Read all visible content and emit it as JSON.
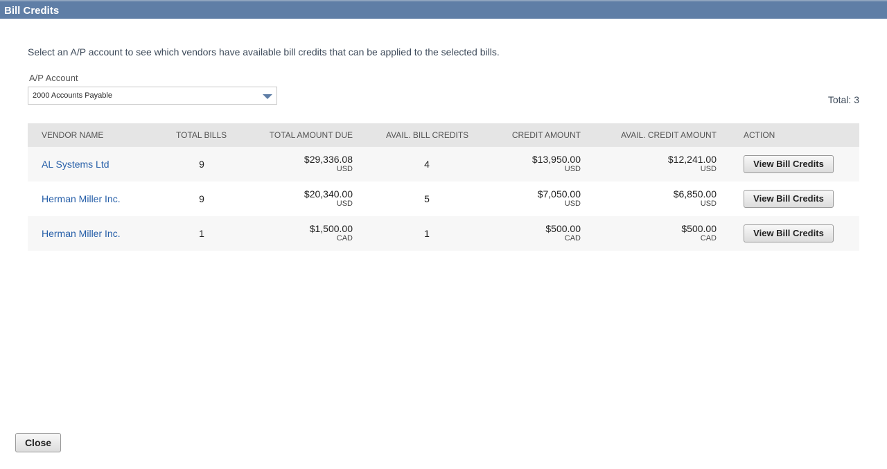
{
  "window": {
    "title": "Bill Credits"
  },
  "instructions": "Select an A/P account to see which vendors have available bill credits that can be applied to the selected bills.",
  "ap_account": {
    "label": "A/P Account",
    "selected": "2000 Accounts Payable",
    "icon": "chevron-down-icon"
  },
  "total": "Total: 3",
  "table": {
    "headers": {
      "vendor_name": "VENDOR NAME",
      "total_bills": "TOTAL BILLS",
      "total_amount_due": "TOTAL AMOUNT DUE",
      "avail_bill_credits": "AVAIL. BILL CREDITS",
      "credit_amount": "CREDIT AMOUNT",
      "avail_credit_amount": "AVAIL. CREDIT AMOUNT",
      "action": "ACTION"
    },
    "rows": [
      {
        "vendor": "AL Systems Ltd",
        "total_bills": "9",
        "total_amount_due": "$29,336.08",
        "total_amount_due_currency": "USD",
        "avail_bill_credits": "4",
        "credit_amount": "$13,950.00",
        "credit_amount_currency": "USD",
        "avail_credit_amount": "$12,241.00",
        "avail_credit_amount_currency": "USD",
        "action_label": "View Bill Credits"
      },
      {
        "vendor": "Herman Miller Inc.",
        "total_bills": "9",
        "total_amount_due": "$20,340.00",
        "total_amount_due_currency": "USD",
        "avail_bill_credits": "5",
        "credit_amount": "$7,050.00",
        "credit_amount_currency": "USD",
        "avail_credit_amount": "$6,850.00",
        "avail_credit_amount_currency": "USD",
        "action_label": "View Bill Credits"
      },
      {
        "vendor": "Herman Miller Inc.",
        "total_bills": "1",
        "total_amount_due": "$1,500.00",
        "total_amount_due_currency": "CAD",
        "avail_bill_credits": "1",
        "credit_amount": "$500.00",
        "credit_amount_currency": "CAD",
        "avail_credit_amount": "$500.00",
        "avail_credit_amount_currency": "CAD",
        "action_label": "View Bill Credits"
      }
    ]
  },
  "footer": {
    "close_label": "Close"
  }
}
